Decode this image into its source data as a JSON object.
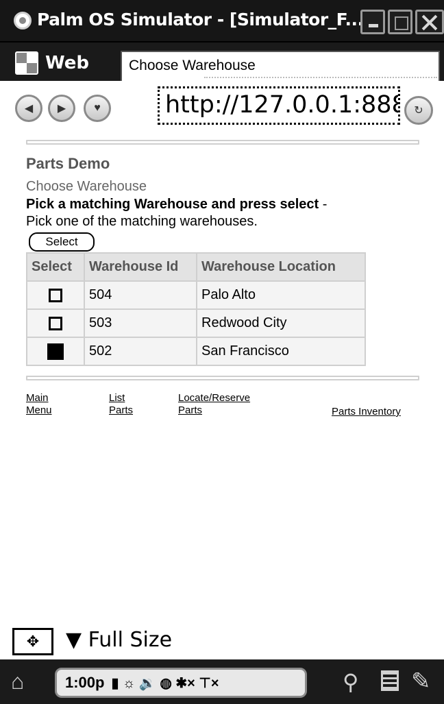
{
  "window": {
    "title": "Palm OS Simulator - [Simulator_F...",
    "title_icon": "palm-icon"
  },
  "browser": {
    "app_tab": "Web",
    "page_tab": "Choose Warehouse",
    "url": "http://127.0.0.1:888",
    "icons": {
      "back": "◀",
      "forward": "▶",
      "favorite": "♥",
      "reload": "↻"
    }
  },
  "page": {
    "app_title": "Parts Demo",
    "subtitle": "Choose Warehouse",
    "instruction_bold": "Pick a matching Warehouse and press select",
    "instruction_dash": " -",
    "instruction_text": "Pick one of the matching warehouses.",
    "select_button": "Select",
    "table": {
      "headers": [
        "Select",
        "Warehouse Id",
        "Warehouse Location"
      ],
      "rows": [
        {
          "checked": false,
          "id": "504",
          "location": "Palo Alto"
        },
        {
          "checked": false,
          "id": "503",
          "location": "Redwood City"
        },
        {
          "checked": true,
          "id": "502",
          "location": "San Francisco"
        }
      ]
    },
    "links": {
      "main_1": "Main",
      "main_2": "Menu",
      "list_1": "List",
      "list_2": "Parts",
      "locate_1": "Locate/Reserve",
      "locate_2": "Parts",
      "inventory": "Parts Inventory"
    }
  },
  "bottom": {
    "move_icon": "✥",
    "size_label": "▼ Full Size",
    "time": "1:00p",
    "status_icons": "▮ ☼ 🔉 ◍ ✱× ⊤×",
    "home_icon": "⌂",
    "search_icon": "⚲",
    "pen_icon": "✎"
  }
}
